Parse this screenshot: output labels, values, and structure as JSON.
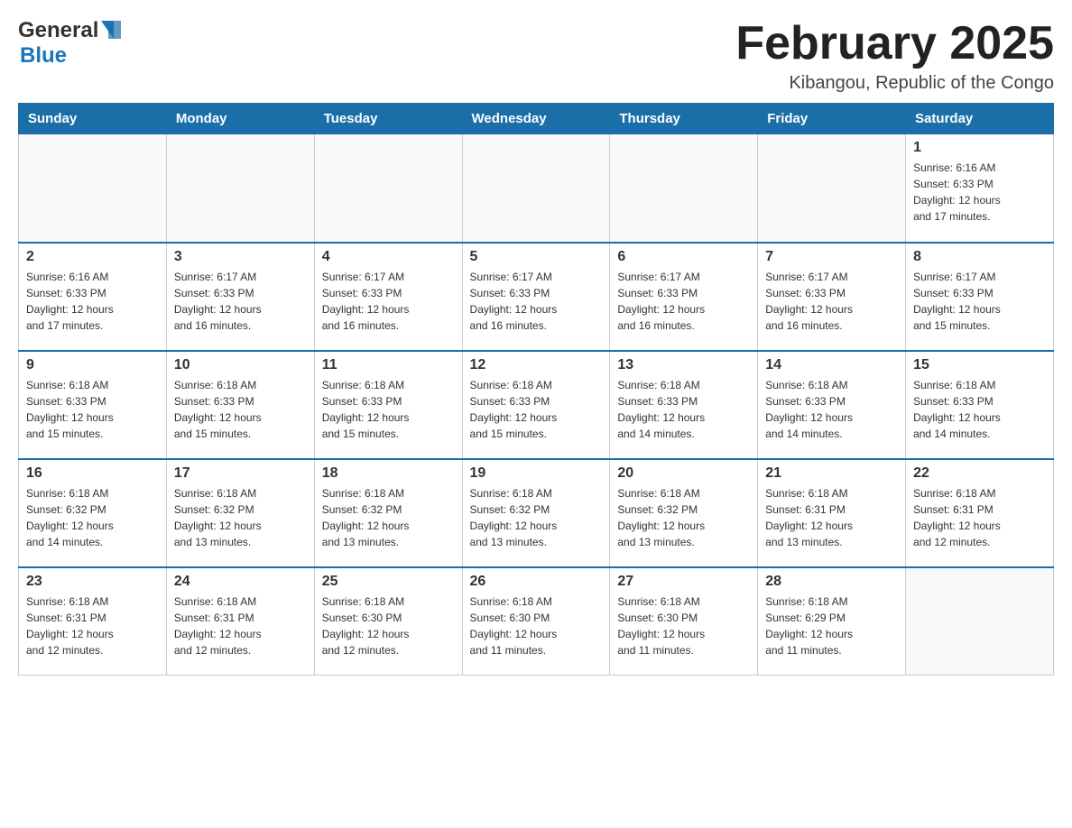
{
  "header": {
    "logo_general": "General",
    "logo_blue": "Blue",
    "month_title": "February 2025",
    "location": "Kibangou, Republic of the Congo"
  },
  "weekdays": [
    "Sunday",
    "Monday",
    "Tuesday",
    "Wednesday",
    "Thursday",
    "Friday",
    "Saturday"
  ],
  "weeks": [
    {
      "days": [
        {
          "num": "",
          "info": ""
        },
        {
          "num": "",
          "info": ""
        },
        {
          "num": "",
          "info": ""
        },
        {
          "num": "",
          "info": ""
        },
        {
          "num": "",
          "info": ""
        },
        {
          "num": "",
          "info": ""
        },
        {
          "num": "1",
          "info": "Sunrise: 6:16 AM\nSunset: 6:33 PM\nDaylight: 12 hours\nand 17 minutes."
        }
      ]
    },
    {
      "days": [
        {
          "num": "2",
          "info": "Sunrise: 6:16 AM\nSunset: 6:33 PM\nDaylight: 12 hours\nand 17 minutes."
        },
        {
          "num": "3",
          "info": "Sunrise: 6:17 AM\nSunset: 6:33 PM\nDaylight: 12 hours\nand 16 minutes."
        },
        {
          "num": "4",
          "info": "Sunrise: 6:17 AM\nSunset: 6:33 PM\nDaylight: 12 hours\nand 16 minutes."
        },
        {
          "num": "5",
          "info": "Sunrise: 6:17 AM\nSunset: 6:33 PM\nDaylight: 12 hours\nand 16 minutes."
        },
        {
          "num": "6",
          "info": "Sunrise: 6:17 AM\nSunset: 6:33 PM\nDaylight: 12 hours\nand 16 minutes."
        },
        {
          "num": "7",
          "info": "Sunrise: 6:17 AM\nSunset: 6:33 PM\nDaylight: 12 hours\nand 16 minutes."
        },
        {
          "num": "8",
          "info": "Sunrise: 6:17 AM\nSunset: 6:33 PM\nDaylight: 12 hours\nand 15 minutes."
        }
      ]
    },
    {
      "days": [
        {
          "num": "9",
          "info": "Sunrise: 6:18 AM\nSunset: 6:33 PM\nDaylight: 12 hours\nand 15 minutes."
        },
        {
          "num": "10",
          "info": "Sunrise: 6:18 AM\nSunset: 6:33 PM\nDaylight: 12 hours\nand 15 minutes."
        },
        {
          "num": "11",
          "info": "Sunrise: 6:18 AM\nSunset: 6:33 PM\nDaylight: 12 hours\nand 15 minutes."
        },
        {
          "num": "12",
          "info": "Sunrise: 6:18 AM\nSunset: 6:33 PM\nDaylight: 12 hours\nand 15 minutes."
        },
        {
          "num": "13",
          "info": "Sunrise: 6:18 AM\nSunset: 6:33 PM\nDaylight: 12 hours\nand 14 minutes."
        },
        {
          "num": "14",
          "info": "Sunrise: 6:18 AM\nSunset: 6:33 PM\nDaylight: 12 hours\nand 14 minutes."
        },
        {
          "num": "15",
          "info": "Sunrise: 6:18 AM\nSunset: 6:33 PM\nDaylight: 12 hours\nand 14 minutes."
        }
      ]
    },
    {
      "days": [
        {
          "num": "16",
          "info": "Sunrise: 6:18 AM\nSunset: 6:32 PM\nDaylight: 12 hours\nand 14 minutes."
        },
        {
          "num": "17",
          "info": "Sunrise: 6:18 AM\nSunset: 6:32 PM\nDaylight: 12 hours\nand 13 minutes."
        },
        {
          "num": "18",
          "info": "Sunrise: 6:18 AM\nSunset: 6:32 PM\nDaylight: 12 hours\nand 13 minutes."
        },
        {
          "num": "19",
          "info": "Sunrise: 6:18 AM\nSunset: 6:32 PM\nDaylight: 12 hours\nand 13 minutes."
        },
        {
          "num": "20",
          "info": "Sunrise: 6:18 AM\nSunset: 6:32 PM\nDaylight: 12 hours\nand 13 minutes."
        },
        {
          "num": "21",
          "info": "Sunrise: 6:18 AM\nSunset: 6:31 PM\nDaylight: 12 hours\nand 13 minutes."
        },
        {
          "num": "22",
          "info": "Sunrise: 6:18 AM\nSunset: 6:31 PM\nDaylight: 12 hours\nand 12 minutes."
        }
      ]
    },
    {
      "days": [
        {
          "num": "23",
          "info": "Sunrise: 6:18 AM\nSunset: 6:31 PM\nDaylight: 12 hours\nand 12 minutes."
        },
        {
          "num": "24",
          "info": "Sunrise: 6:18 AM\nSunset: 6:31 PM\nDaylight: 12 hours\nand 12 minutes."
        },
        {
          "num": "25",
          "info": "Sunrise: 6:18 AM\nSunset: 6:30 PM\nDaylight: 12 hours\nand 12 minutes."
        },
        {
          "num": "26",
          "info": "Sunrise: 6:18 AM\nSunset: 6:30 PM\nDaylight: 12 hours\nand 11 minutes."
        },
        {
          "num": "27",
          "info": "Sunrise: 6:18 AM\nSunset: 6:30 PM\nDaylight: 12 hours\nand 11 minutes."
        },
        {
          "num": "28",
          "info": "Sunrise: 6:18 AM\nSunset: 6:29 PM\nDaylight: 12 hours\nand 11 minutes."
        },
        {
          "num": "",
          "info": ""
        }
      ]
    }
  ]
}
